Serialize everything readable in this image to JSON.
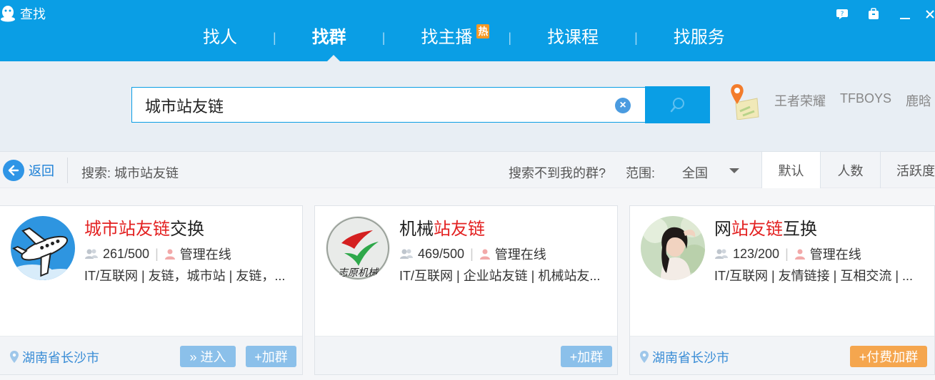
{
  "window": {
    "title": "查找",
    "controls": [
      "feedback-icon",
      "backpack-icon",
      "minimize-icon",
      "close-icon"
    ]
  },
  "nav": {
    "tabs": [
      {
        "label": "找人",
        "active": false
      },
      {
        "label": "找群",
        "active": true
      },
      {
        "label": "找主播",
        "active": false,
        "badge": "热"
      },
      {
        "label": "找课程",
        "active": false
      },
      {
        "label": "找服务",
        "active": false
      }
    ],
    "separator": "|"
  },
  "search": {
    "value": "城市站友链",
    "clear_icon": "close-circle-icon",
    "button_icon": "search-icon",
    "hot_words": [
      "王者荣耀",
      "TFBOYS",
      "鹿晗"
    ]
  },
  "filter": {
    "back_label": "返回",
    "crumb": "搜索: 城市站友链",
    "cant_find": "搜索不到我的群?",
    "range_label": "范围:",
    "range_value": "全国",
    "sort_tabs": [
      {
        "label": "默认",
        "active": true
      },
      {
        "label": "人数",
        "active": false
      },
      {
        "label": "活跃度",
        "active": false
      }
    ]
  },
  "cards": [
    {
      "title_pre": "",
      "title_hl": "城市站友链",
      "title_post": "交换",
      "members": "261/500",
      "admin": "管理在线",
      "tags": "IT/互联网 | 友链，城市站 | 友链，...",
      "location": "湖南省长沙市",
      "buttons": [
        "» 进入",
        "+加群"
      ]
    },
    {
      "title_pre": "机械",
      "title_hl": "站友链",
      "title_post": "",
      "members": "469/500",
      "admin": "管理在线",
      "tags": "IT/互联网 | 企业站友链 | 机械站友...",
      "location": "",
      "buttons": [
        "+加群"
      ]
    },
    {
      "title_pre": "网",
      "title_hl": "站友链",
      "title_post": "互换",
      "members": "123/200",
      "admin": "管理在线",
      "tags": "IT/互联网 | 友情链接 | 互相交流 | ...",
      "location": "湖南省长沙市",
      "buttons": [
        "+付费加群"
      ]
    }
  ],
  "colors": {
    "brand_blue": "#0a9ee5",
    "highlight_red": "#e32222",
    "hot_orange": "#f69822",
    "link_blue": "#3a8dd6"
  }
}
